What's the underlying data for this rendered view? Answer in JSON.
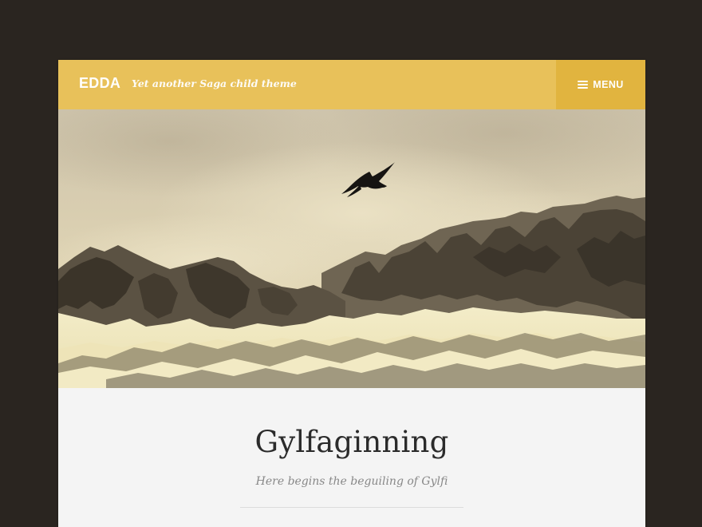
{
  "site": {
    "title": "EDDA",
    "tagline": "Yet another Saga child theme"
  },
  "menu": {
    "label": "MENU",
    "icon": "hamburger-menu-icon"
  },
  "hero": {
    "image": "mountain-bird-header-image"
  },
  "post": {
    "title": "Gylfaginning",
    "subtitle": "Here begins the beguiling of Gylfi"
  },
  "colors": {
    "background": "#2a2520",
    "header": "#e8c15a",
    "menu_button": "#e1b43f",
    "content_bg": "#f4f4f4",
    "title_text": "#2b2b2b",
    "subtitle_text": "#888888"
  }
}
